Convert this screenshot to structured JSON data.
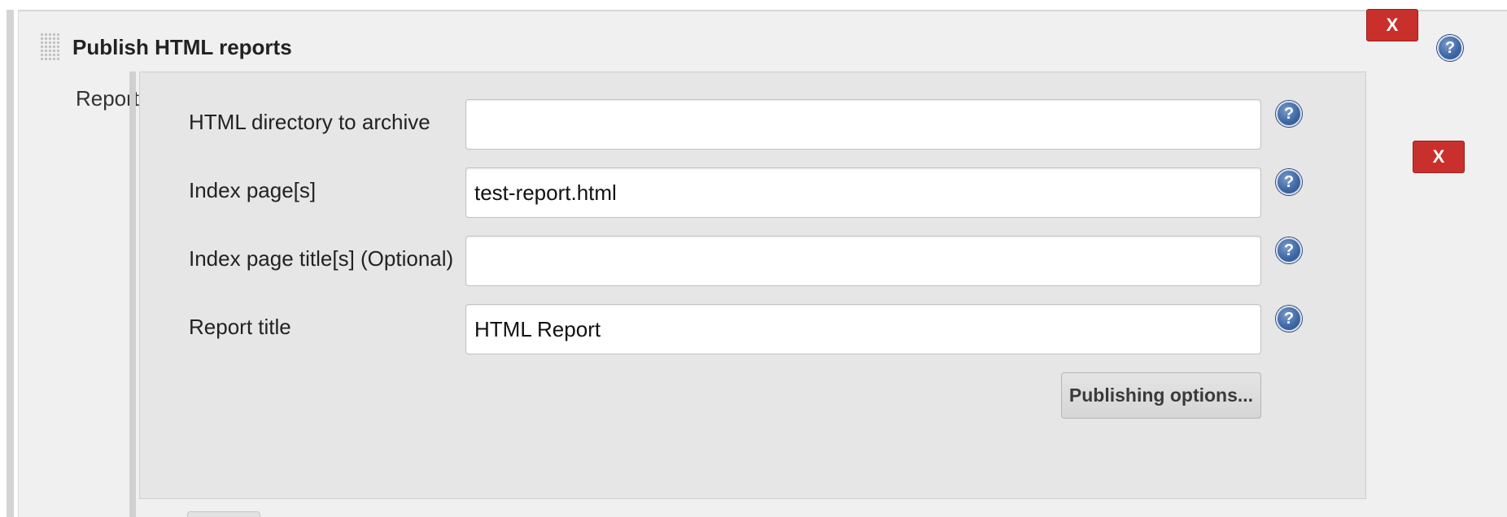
{
  "section": {
    "title": "Publish HTML reports",
    "delete_label": "X",
    "help_glyph": "?",
    "icons": {
      "drag": "drag-handle-icon",
      "help": "help-icon"
    }
  },
  "reports": {
    "label": "Reports",
    "delete_label": "X",
    "fields": [
      {
        "label": "HTML directory to archive",
        "value": "",
        "help_glyph": "?"
      },
      {
        "label": "Index page[s]",
        "value": "test-report.html",
        "help_glyph": "?"
      },
      {
        "label": "Index page title[s] (Optional)",
        "value": "",
        "help_glyph": "?"
      },
      {
        "label": "Report title",
        "value": "HTML Report",
        "help_glyph": "?"
      }
    ],
    "publishing_options_label": "Publishing options..."
  },
  "colors": {
    "delete_button": "#c9302c",
    "help_icon": "#3f69a7",
    "panel_background": "#f0f0f0",
    "inner_panel_background": "#e6e6e6"
  }
}
